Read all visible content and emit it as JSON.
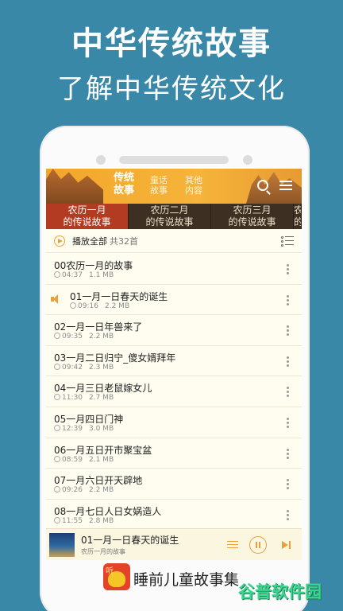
{
  "promo": {
    "title": "中华传统故事",
    "subtitle": "了解中华传统文化"
  },
  "header": {
    "tabs": [
      {
        "label": "传统\n故事",
        "active": true
      },
      {
        "label": "童话\n故事",
        "active": false
      },
      {
        "label": "其他\n内容",
        "active": false
      }
    ],
    "search_icon": "search-icon",
    "menu_icon": "menu-icon"
  },
  "month_tabs": [
    {
      "label": "农历一月\n的传说故事",
      "active": true
    },
    {
      "label": "农历二月\n的传说故事",
      "active": false
    },
    {
      "label": "农历三月\n的传说故事",
      "active": false
    },
    {
      "label": "农\n的",
      "active": false
    }
  ],
  "play_all": {
    "label": "播放全部",
    "count": "共32首"
  },
  "tracks": [
    {
      "title": "00农历一月的故事",
      "duration": "04:37",
      "size": "1.1 MB",
      "playing": false
    },
    {
      "title": "01一月一日春天的诞生",
      "duration": "09:16",
      "size": "2.2 MB",
      "playing": true
    },
    {
      "title": "02一月一日年兽来了",
      "duration": "09:35",
      "size": "2.2 MB",
      "playing": false
    },
    {
      "title": "03一月二日归宁_傻女婿拜年",
      "duration": "09:42",
      "size": "2.3 MB",
      "playing": false
    },
    {
      "title": "04一月三日老鼠嫁女儿",
      "duration": "11:30",
      "size": "2.7 MB",
      "playing": false
    },
    {
      "title": "05一月四日门神",
      "duration": "12:39",
      "size": "3.0 MB",
      "playing": false
    },
    {
      "title": "06一月五日开市聚宝盆",
      "duration": "08:59",
      "size": "2.1 MB",
      "playing": false
    },
    {
      "title": "07一月六日开天辟地",
      "duration": "09:26",
      "size": "2.2 MB",
      "playing": false
    },
    {
      "title": "08一月七日人日女娲造人",
      "duration": "11:55",
      "size": "2.8 MB",
      "playing": false
    }
  ],
  "player": {
    "title": "01一月一日春天的诞生",
    "subtitle": "农历一月的故事",
    "state": "playing"
  },
  "app": {
    "icon_text": "听",
    "name": "睡前儿童故事集"
  },
  "watermark": "谷普软件园"
}
